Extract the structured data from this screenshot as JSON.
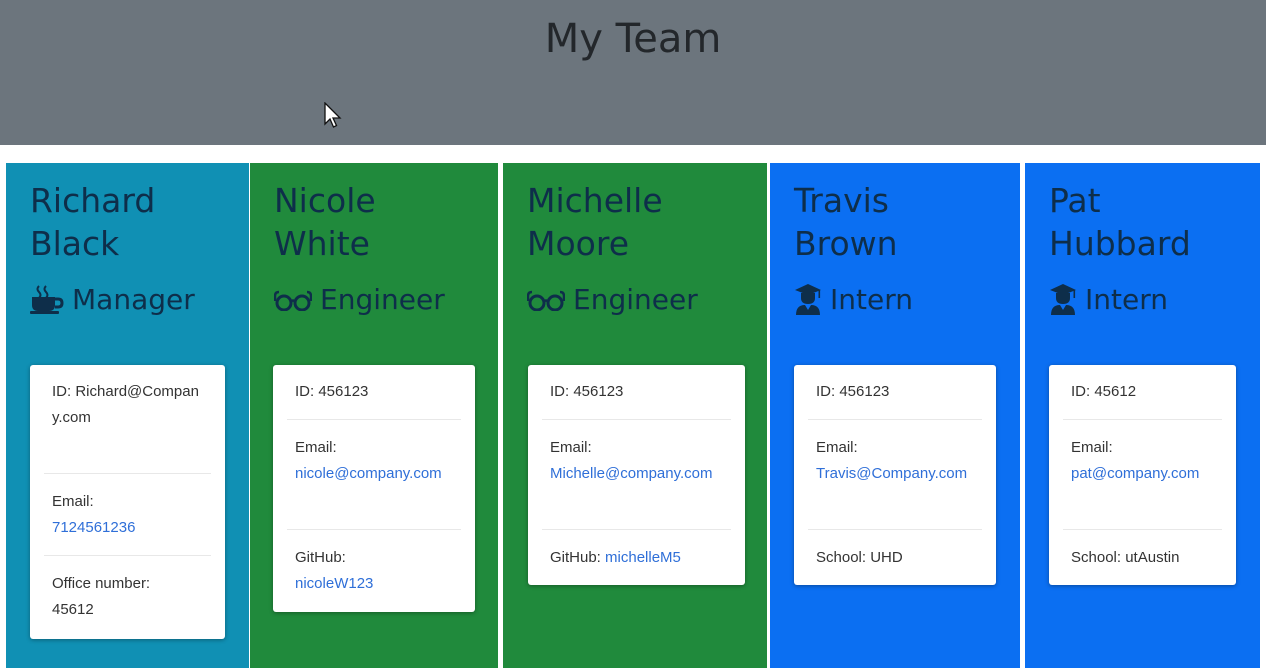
{
  "header": {
    "title": "My Team"
  },
  "colors": {
    "header_bg": "#6c757d",
    "manager": "#1090b4",
    "engineer": "#208a3c",
    "intern": "#0b6ff2",
    "link": "#2f6fd8"
  },
  "cards": [
    {
      "first": "Richard",
      "last": "Black",
      "role": "Manager",
      "icon": "coffee-icon",
      "id_label": "ID:",
      "id_value": "Richard@Company.com",
      "email_label": "Email:",
      "email_value": "7124561236",
      "extra_label": "Office number:",
      "extra_value": "45612"
    },
    {
      "first": "Nicole",
      "last": "White",
      "role": "Engineer",
      "icon": "glasses-icon",
      "id_label": "ID:",
      "id_value": "456123",
      "email_label": "Email:",
      "email_value": "nicole@company.com",
      "extra_label": "GitHub:",
      "extra_value": "nicoleW123"
    },
    {
      "first": "Michelle",
      "last": "Moore",
      "role": "Engineer",
      "icon": "glasses-icon",
      "id_label": "ID:",
      "id_value": "456123",
      "email_label": "Email:",
      "email_value": "Michelle@company.com",
      "extra_label": "GitHub:",
      "extra_value": "michelleM5"
    },
    {
      "first": "Travis",
      "last": "Brown",
      "role": "Intern",
      "icon": "graduate-icon",
      "id_label": "ID:",
      "id_value": "456123",
      "email_label": "Email:",
      "email_value": "Travis@Company.com",
      "extra_label": "School:",
      "extra_value": "UHD"
    },
    {
      "first": "Pat",
      "last": "Hubbard",
      "role": "Intern",
      "icon": "graduate-icon",
      "id_label": "ID:",
      "id_value": "45612",
      "email_label": "Email:",
      "email_value": "pat@company.com",
      "extra_label": "School:",
      "extra_value": "utAustin"
    }
  ]
}
